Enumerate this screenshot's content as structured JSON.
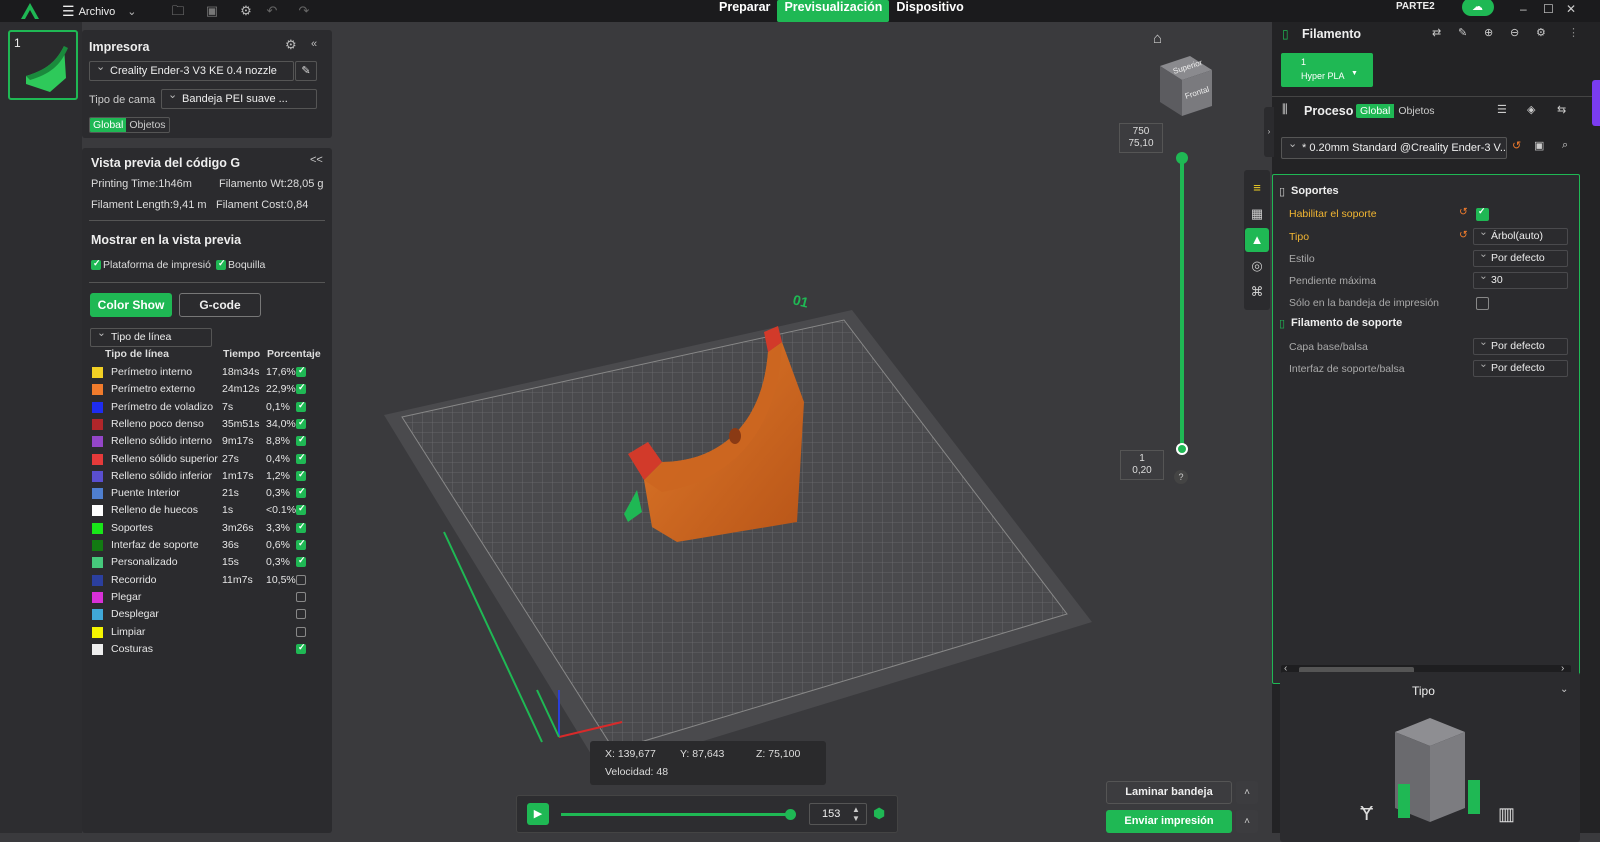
{
  "app": {
    "menu_label": "Archivo",
    "title": "PARTE2"
  },
  "tabs": [
    {
      "label": "Preparar"
    },
    {
      "label": "Previsualización"
    },
    {
      "label": "Dispositivo"
    }
  ],
  "plate": {
    "number": "1"
  },
  "printer": {
    "title": "Impresora",
    "model": "Creality Ender-3 V3 KE 0.4 nozzle",
    "bed_label": "Tipo de cama",
    "bed_value": "Bandeja PEI suave ...",
    "seg_global": "Global",
    "seg_objects": "Objetos"
  },
  "gcode": {
    "title": "Vista previa del código G",
    "collapse": "<<",
    "printing_time": "Printing Time:1h46m",
    "filament_wt": "Filamento Wt:28,05 g",
    "filament_length": "Filament Length:9,41 m",
    "filament_cost": "Filament Cost:0,84",
    "show_title": "Mostrar en la vista previa",
    "opt_plate": "Plataforma de impresió",
    "opt_nozzle": "Boquilla",
    "btn_color": "Color Show",
    "btn_gcode": "G-code",
    "line_type_select": "Tipo de línea",
    "col_type": "Tipo de línea",
    "col_time": "Tiempo",
    "col_pct": "Porcentaje"
  },
  "legend": [
    {
      "name": "Perímetro interno",
      "time": "18m34s",
      "pct": "17,6%",
      "color": "#f2d024",
      "checked": true
    },
    {
      "name": "Perímetro externo",
      "time": "24m12s",
      "pct": "22,9%",
      "color": "#f07b2c",
      "checked": true
    },
    {
      "name": "Perímetro de voladizo",
      "time": "7s",
      "pct": "0,1%",
      "color": "#1e2cf0",
      "checked": true
    },
    {
      "name": "Relleno poco denso",
      "time": "35m51s",
      "pct": "34,0%",
      "color": "#b0262a",
      "checked": true
    },
    {
      "name": "Relleno sólido interno",
      "time": "9m17s",
      "pct": "8,8%",
      "color": "#9446c8",
      "checked": true
    },
    {
      "name": "Relleno sólido superior",
      "time": "27s",
      "pct": "0,4%",
      "color": "#e53a3a",
      "checked": true
    },
    {
      "name": "Relleno sólido inferior",
      "time": "1m17s",
      "pct": "1,2%",
      "color": "#5a4fcf",
      "checked": true
    },
    {
      "name": "Puente Interior",
      "time": "21s",
      "pct": "0,3%",
      "color": "#4f7fcf",
      "checked": true
    },
    {
      "name": "Relleno de huecos",
      "time": "1s",
      "pct": "<0.1%",
      "color": "#ffffff",
      "checked": true
    },
    {
      "name": "Soportes",
      "time": "3m26s",
      "pct": "3,3%",
      "color": "#19e619",
      "checked": true
    },
    {
      "name": "Interfaz de soporte",
      "time": "36s",
      "pct": "0,6%",
      "color": "#127a12",
      "checked": true
    },
    {
      "name": "Personalizado",
      "time": "15s",
      "pct": "0,3%",
      "color": "#46c87c",
      "checked": true
    },
    {
      "name": "Recorrido",
      "time": "11m7s",
      "pct": "10,5%",
      "color": "#2b3f9e",
      "checked": false
    },
    {
      "name": "Plegar",
      "time": "",
      "pct": "",
      "color": "#d830d8",
      "checked": false
    },
    {
      "name": "Desplegar",
      "time": "",
      "pct": "",
      "color": "#40a8d8",
      "checked": false
    },
    {
      "name": "Limpiar",
      "time": "",
      "pct": "",
      "color": "#f4f400",
      "checked": false
    },
    {
      "name": "Costuras",
      "time": "",
      "pct": "",
      "color": "#eeeeee",
      "checked": true
    }
  ],
  "viewcube": {
    "top": "Superior",
    "front": "Frontal"
  },
  "plate_label": "01",
  "layer_slider": {
    "top_layer": "750",
    "top_height": "75,10",
    "bottom_layer": "1",
    "bottom_height": "0,20",
    "help": "?"
  },
  "coords": {
    "x": "X: 139,677",
    "y": "Y: 87,643",
    "z": "Z: 75,100",
    "speed": "Velocidad: 48"
  },
  "playback": {
    "value": "153",
    "progress": 0.98
  },
  "actions": {
    "slice": "Laminar bandeja",
    "send": "Enviar impresión"
  },
  "filament_panel": {
    "title": "Filamento",
    "slot": "1",
    "material": "Hyper PLA",
    "color": "#1fb854"
  },
  "process": {
    "title": "Proceso",
    "seg_global": "Global",
    "seg_objects": "Objetos",
    "profile": "* 0.20mm Standard @Creality Ender-3 V...",
    "section_support": "Soportes",
    "enable_support": "Habilitar el soporte",
    "type_label": "Tipo",
    "type_value": "Árbol(auto)",
    "style_label": "Estilo",
    "style_value": "Por defecto",
    "threshold_label": "Pendiente máxima",
    "threshold_value": "30",
    "bed_only_label": "Sólo en la bandeja de impresión",
    "section_filament": "Filamento de soporte",
    "base_label": "Capa base/balsa",
    "base_value": "Por defecto",
    "interface_label": "Interfaz de soporte/balsa",
    "interface_value": "Por defecto"
  },
  "preview_tipo": {
    "title": "Tipo"
  }
}
